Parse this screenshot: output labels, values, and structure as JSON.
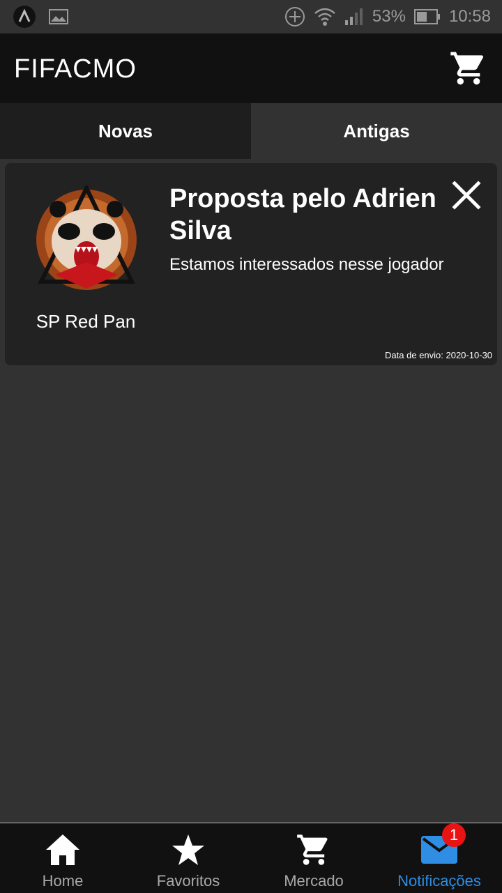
{
  "status_bar": {
    "battery": "53%",
    "time": "10:58",
    "icons": [
      "app-logo-icon",
      "image-icon",
      "add-circle-icon",
      "wifi-icon",
      "signal-icon",
      "battery-icon"
    ]
  },
  "app_bar": {
    "title": "FIFACMO",
    "cart_icon": "cart-icon"
  },
  "tabs": [
    {
      "label": "Novas",
      "active": true
    },
    {
      "label": "Antigas",
      "active": false
    }
  ],
  "notification": {
    "team_name": "SP Red Pan",
    "title": "Proposta pelo Adrien Silva",
    "message": "Estamos interessados nesse jogador",
    "date": "Data de envio: 2020-10-30",
    "close_icon": "close-icon"
  },
  "bottom_nav": {
    "items": [
      {
        "label": "Home",
        "icon": "home-icon"
      },
      {
        "label": "Favoritos",
        "icon": "star-icon"
      },
      {
        "label": "Mercado",
        "icon": "cart-icon"
      },
      {
        "label": "Notificações",
        "icon": "mail-icon",
        "active": true,
        "badge": "1"
      }
    ]
  },
  "colors": {
    "accent": "#2f8de4",
    "badge": "#e81313",
    "background": "#323232",
    "bar": "#111111",
    "card": "#222222"
  }
}
